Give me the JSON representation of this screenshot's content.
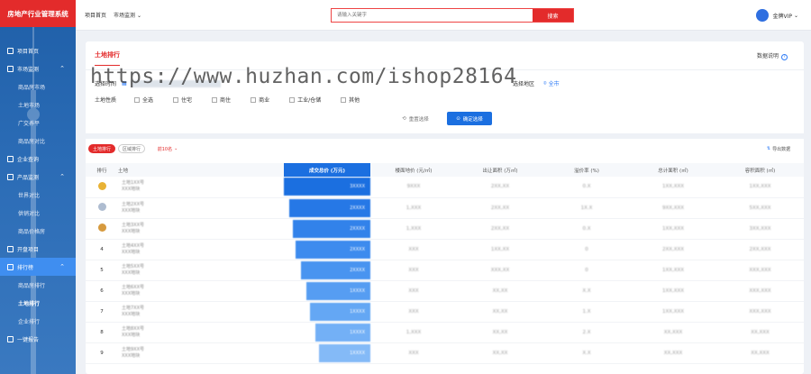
{
  "sidebar": {
    "brand": "房地产行业管理系统",
    "items": [
      {
        "type": "item",
        "label": "项目首页",
        "icon": "home-icon"
      },
      {
        "type": "item",
        "label": "市场监测",
        "icon": "monitor-icon",
        "chevron": "⌃"
      },
      {
        "type": "sub",
        "label": "商品房市场"
      },
      {
        "type": "sub",
        "label": "土地市场"
      },
      {
        "type": "sub",
        "label": "广交养平"
      },
      {
        "type": "sub",
        "label": "商品房对比"
      },
      {
        "type": "item",
        "label": "企业查询",
        "icon": "enterprise-icon"
      },
      {
        "type": "item",
        "label": "产品监测",
        "icon": "product-icon",
        "chevron": "⌃"
      },
      {
        "type": "sub",
        "label": "世界对比"
      },
      {
        "type": "sub",
        "label": "供销对比"
      },
      {
        "type": "sub",
        "label": "商品价格房"
      },
      {
        "type": "item",
        "label": "开盘项目",
        "icon": "calendar-icon"
      },
      {
        "type": "item",
        "label": "排行榜",
        "icon": "ranking-icon",
        "chevron": "⌃",
        "active": true
      },
      {
        "type": "sub",
        "label": "商品房排行"
      },
      {
        "type": "sub",
        "label": "土地排行",
        "active": true
      },
      {
        "type": "sub",
        "label": "企业排行"
      },
      {
        "type": "item",
        "label": "一键报告",
        "icon": "report-icon"
      }
    ]
  },
  "topbar": {
    "home": "项目首页",
    "market": "市场监测",
    "search_placeholder": "请输入关键字",
    "search_button": "搜索",
    "user": "金牌VIP"
  },
  "main": {
    "title": "土地排行",
    "data_note": "数据说明",
    "time_label": "选择时间",
    "region_label": "选择地区",
    "region_value": "全市",
    "use_label": "土地性质",
    "use_options": [
      "全选",
      "住宅",
      "商住",
      "商业",
      "工业/仓储",
      "其他"
    ],
    "reset": "重置选择",
    "confirm": "确定选择",
    "tab_active": "土地排行",
    "tab_other": "区域排行",
    "count_select": "前10名",
    "export": "导出数据",
    "columns": [
      "排行",
      "土地",
      "成交总价 (万元)",
      "楼面地价 (元/㎡)",
      "出让面积 (万㎡)",
      "溢价率 (%)",
      "总计面积 (㎡)",
      "容积面积 (㎡)"
    ],
    "watermark": "https://www.huzhan.com/ishop28164"
  },
  "rows": [
    {
      "rank": "",
      "medal": "gold",
      "name": "土地1XX号",
      "sub": "XXX地块",
      "total": "3XXXX",
      "c3": "9XXX",
      "c4": "2XX,XX",
      "c5": "0.X",
      "c6": "1XX,XXX",
      "c7": "1XX,XXX",
      "bar": 1.0
    },
    {
      "rank": "",
      "medal": "silver",
      "name": "土地2XX号",
      "sub": "XXX地块",
      "total": "2XXXX",
      "c3": "1,XXX",
      "c4": "2XX,XX",
      "c5": "1X.X",
      "c6": "9XX,XXX",
      "c7": "5XX,XXX",
      "bar": 0.94
    },
    {
      "rank": "",
      "medal": "bronze",
      "name": "土地3XX号",
      "sub": "XXX地块",
      "total": "2XXXX",
      "c3": "1,XXX",
      "c4": "2XX,XX",
      "c5": "0.X",
      "c6": "1XX,XXX",
      "c7": "3XX,XXX",
      "bar": 0.9
    },
    {
      "rank": "4",
      "medal": "",
      "name": "土地4XX号",
      "sub": "XXX地块",
      "total": "2XXXX",
      "c3": "XXX",
      "c4": "1XX,XX",
      "c5": "0",
      "c6": "2XX,XXX",
      "c7": "2XX,XXX",
      "bar": 0.86
    },
    {
      "rank": "5",
      "medal": "",
      "name": "土地5XX号",
      "sub": "XXX地块",
      "total": "2XXXX",
      "c3": "XXX",
      "c4": "XXX,XX",
      "c5": "0",
      "c6": "1XX,XXX",
      "c7": "XXX,XXX",
      "bar": 0.8
    },
    {
      "rank": "6",
      "medal": "",
      "name": "土地6XX号",
      "sub": "XXX地块",
      "total": "1XXXX",
      "c3": "XXX",
      "c4": "XX,XX",
      "c5": "X.X",
      "c6": "1XX,XXX",
      "c7": "XXX,XXX",
      "bar": 0.74
    },
    {
      "rank": "7",
      "medal": "",
      "name": "土地7XX号",
      "sub": "XXX地块",
      "total": "1XXXX",
      "c3": "XXX",
      "c4": "XX,XX",
      "c5": "1.X",
      "c6": "1XX,XXX",
      "c7": "XXX,XXX",
      "bar": 0.7
    },
    {
      "rank": "8",
      "medal": "",
      "name": "土地8XX号",
      "sub": "XXX地块",
      "total": "1XXXX",
      "c3": "1,XXX",
      "c4": "XX,XX",
      "c5": "2.X",
      "c6": "XX,XXX",
      "c7": "XX,XXX",
      "bar": 0.64
    },
    {
      "rank": "9",
      "medal": "",
      "name": "土地9XX号",
      "sub": "XXX地块",
      "total": "1XXXX",
      "c3": "XXX",
      "c4": "XX,XX",
      "c5": "X.X",
      "c6": "XX,XXX",
      "c7": "XX,XXX",
      "bar": 0.59
    }
  ],
  "colors": {
    "brand_red": "#e32b2b",
    "accent_blue": "#1b6fe0",
    "gold": "#e8b235",
    "silver": "#aebcd0",
    "bronze": "#d69a3e"
  }
}
